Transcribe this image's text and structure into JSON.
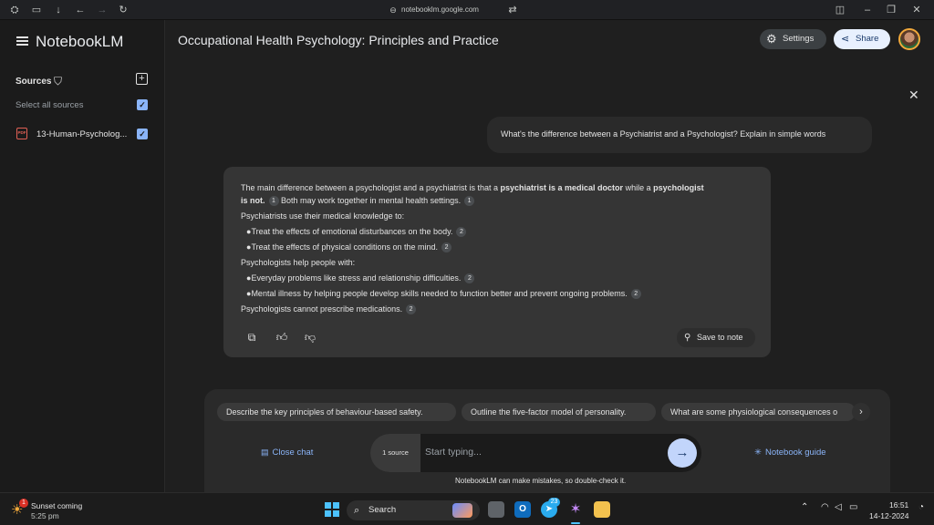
{
  "browser": {
    "url": "notebooklm.google.com"
  },
  "sidebar": {
    "app_name": "NotebookLM",
    "sources_title": "Sources",
    "select_all": "Select all sources",
    "source_name": "13-Human-Psycholog...",
    "pdf_badge": "PDF"
  },
  "header": {
    "notebook_title": "Occupational Health Psychology: Principles and Practice",
    "settings_label": "Settings",
    "share_label": "Share"
  },
  "chat": {
    "user_message": "What's the difference between a Psychiatrist and a Psychologist? Explain in simple words",
    "answer": {
      "l1_a": "The main difference between a psychologist and a psychiatrist is that a ",
      "l1_b": "psychiatrist is a medical doctor",
      "l1_c": " while a ",
      "l1_d": "psychologist",
      "l2_a": "is not.",
      "l2_b": "Both may work together in mental health settings.",
      "l3": "Psychiatrists use their medical knowledge to:",
      "l4": "Treat the effects of emotional disturbances on the body.",
      "l5": "Treat the effects of physical conditions on the mind.",
      "l6": "Psychologists help people with:",
      "l7": "Everyday problems like stress and relationship difficulties.",
      "l8": "Mental illness by helping people develop skills needed to function better and prevent ongoing problems.",
      "l9": "Psychologists cannot prescribe medications.",
      "cite1": "1",
      "cite2": "2"
    },
    "save_to_note": "Save to note"
  },
  "suggestions": [
    "Describe the key principles of behaviour-based safety.",
    "Outline the five-factor model of personality.",
    "What are some physiological consequences o"
  ],
  "composer": {
    "close_chat": "Close chat",
    "source_count": "1 source",
    "placeholder": "Start typing...",
    "notebook_guide": "Notebook guide",
    "disclaimer": "NotebookLM can make mistakes, so double-check it."
  },
  "taskbar": {
    "weather_title": "Sunset coming",
    "weather_time": "5:25 pm",
    "weather_badge": "1",
    "search_label": "Search",
    "telegram_badge": "23",
    "time": "16:51",
    "date": "14-12-2024"
  },
  "colors": {
    "accent": "#8ab4f8",
    "panel": "#353535",
    "background": "#1f1f1f"
  }
}
